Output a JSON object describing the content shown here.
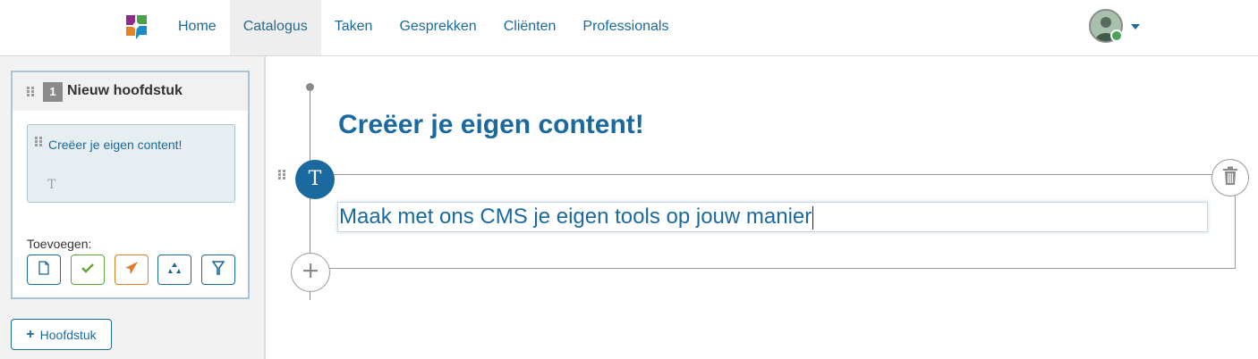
{
  "nav": {
    "items": [
      {
        "label": "Home",
        "active": false
      },
      {
        "label": "Catalogus",
        "active": true
      },
      {
        "label": "Taken",
        "active": false
      },
      {
        "label": "Gesprekken",
        "active": false
      },
      {
        "label": "Cliënten",
        "active": false
      },
      {
        "label": "Professionals",
        "active": false
      }
    ],
    "logo_icon": "app-logo",
    "user_menu_icon": "chevron-down-icon"
  },
  "sidebar": {
    "chapter": {
      "number": "1",
      "title": "Nieuw hoofdstuk",
      "page": {
        "title": "Creëer je eigen content!",
        "type_icon": "T"
      },
      "add_label": "Toevoegen:",
      "add_buttons": [
        {
          "icon": "document-icon",
          "color": "#1a6a9a"
        },
        {
          "icon": "check-icon",
          "color": "#5aa83a"
        },
        {
          "icon": "send-icon",
          "color": "#e07a2a"
        },
        {
          "icon": "recycle-icon",
          "color": "#1a6a9a"
        },
        {
          "icon": "filter-icon",
          "color": "#1a6a9a"
        }
      ]
    },
    "add_chapter_label": "Hoofdstuk"
  },
  "editor": {
    "heading": "Creëer je eigen content!",
    "block_type": "T",
    "text_value": "Maak met ons CMS je eigen tools op jouw manier"
  },
  "colors": {
    "primary": "#1a6aa0",
    "nav_text": "#1a6a9a",
    "border": "#a9c4d6"
  }
}
